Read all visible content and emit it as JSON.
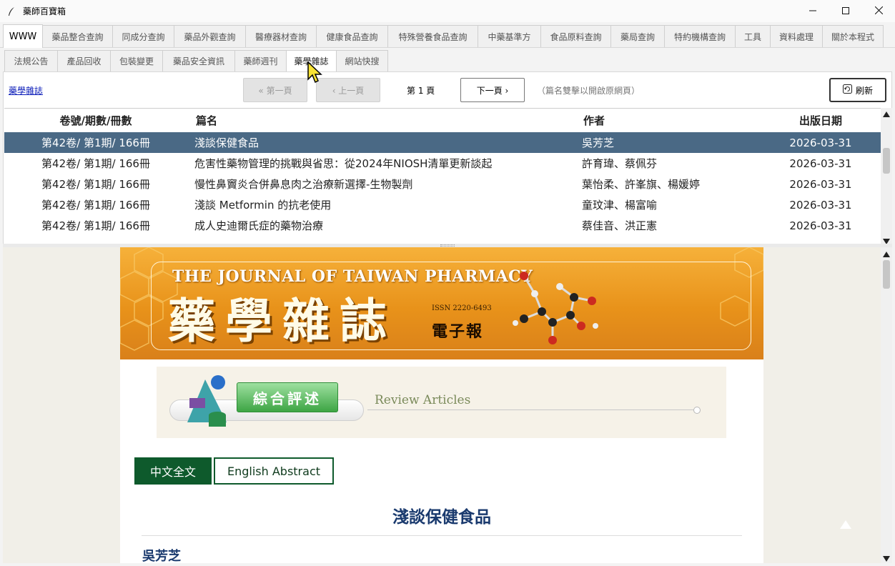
{
  "window": {
    "title": "藥師百寶箱",
    "icon": "feather-pen-icon"
  },
  "tabs_main": [
    "WWW",
    "藥品整合查詢",
    "同成分查詢",
    "藥品外觀查詢",
    "醫療器材查詢",
    "健康食品查詢",
    "特殊營養食品查詢",
    "中藥基準方",
    "食品原料查詢",
    "藥局查詢",
    "特約機構查詢",
    "工具",
    "資料處理",
    "關於本程式"
  ],
  "tabs_sub": [
    "法規公告",
    "產品回收",
    "包裝變更",
    "藥品安全資訊",
    "藥師週刊",
    "藥學雜誌",
    "網站快搜"
  ],
  "toolbar": {
    "source_link": "藥學雜誌",
    "first_page": "« 第一頁",
    "prev_page": "‹ 上一頁",
    "page_label": "第 1 頁",
    "next_page": "下一頁 ›",
    "hint": "（篇名雙擊以開啟原網頁）",
    "refresh": "刷新"
  },
  "table": {
    "headers": [
      "卷號/期數/冊數",
      "篇名",
      "作者",
      "出版日期"
    ],
    "rows": [
      {
        "vol": "第42卷/ 第1期/ 166冊",
        "title": "淺談保健食品",
        "author": "吳芳芝",
        "date": "2026-03-31"
      },
      {
        "vol": "第42卷/ 第1期/ 166冊",
        "title": "危害性藥物管理的挑戰與省思：從2024年NIOSH清單更新談起",
        "author": "許育瑋、蔡佩芬",
        "date": "2026-03-31"
      },
      {
        "vol": "第42卷/ 第1期/ 166冊",
        "title": "慢性鼻竇炎合併鼻息肉之治療新選擇-生物製劑",
        "author": "葉怡柔、許峯旗、楊媛婷",
        "date": "2026-03-31"
      },
      {
        "vol": "第42卷/ 第1期/ 166冊",
        "title": "淺談 Metformin 的抗老使用",
        "author": "童玟津、楊富喻",
        "date": "2026-03-31"
      },
      {
        "vol": "第42卷/ 第1期/ 166冊",
        "title": "成人史迪爾氏症的藥物治療",
        "author": "蔡佳音、洪正憲",
        "date": "2026-03-31"
      }
    ]
  },
  "web": {
    "banner_en": "THE JOURNAL OF TAIWAN PHARMACY",
    "banner_zh": "藥學雜誌",
    "banner_issn": "ISSN 2220-6493",
    "banner_e": "電子報",
    "section_zh": "綜合評述",
    "section_en": "Review Articles",
    "btn_zh": "中文全文",
    "btn_en": "English Abstract",
    "article_title": "淺談保健食品",
    "article_author": "吳芳芝"
  },
  "colors": {
    "selected_row": "#4a6985",
    "banner": "#e8921a",
    "dark_green": "#0e5a2c",
    "title_blue": "#1a3a6e"
  }
}
